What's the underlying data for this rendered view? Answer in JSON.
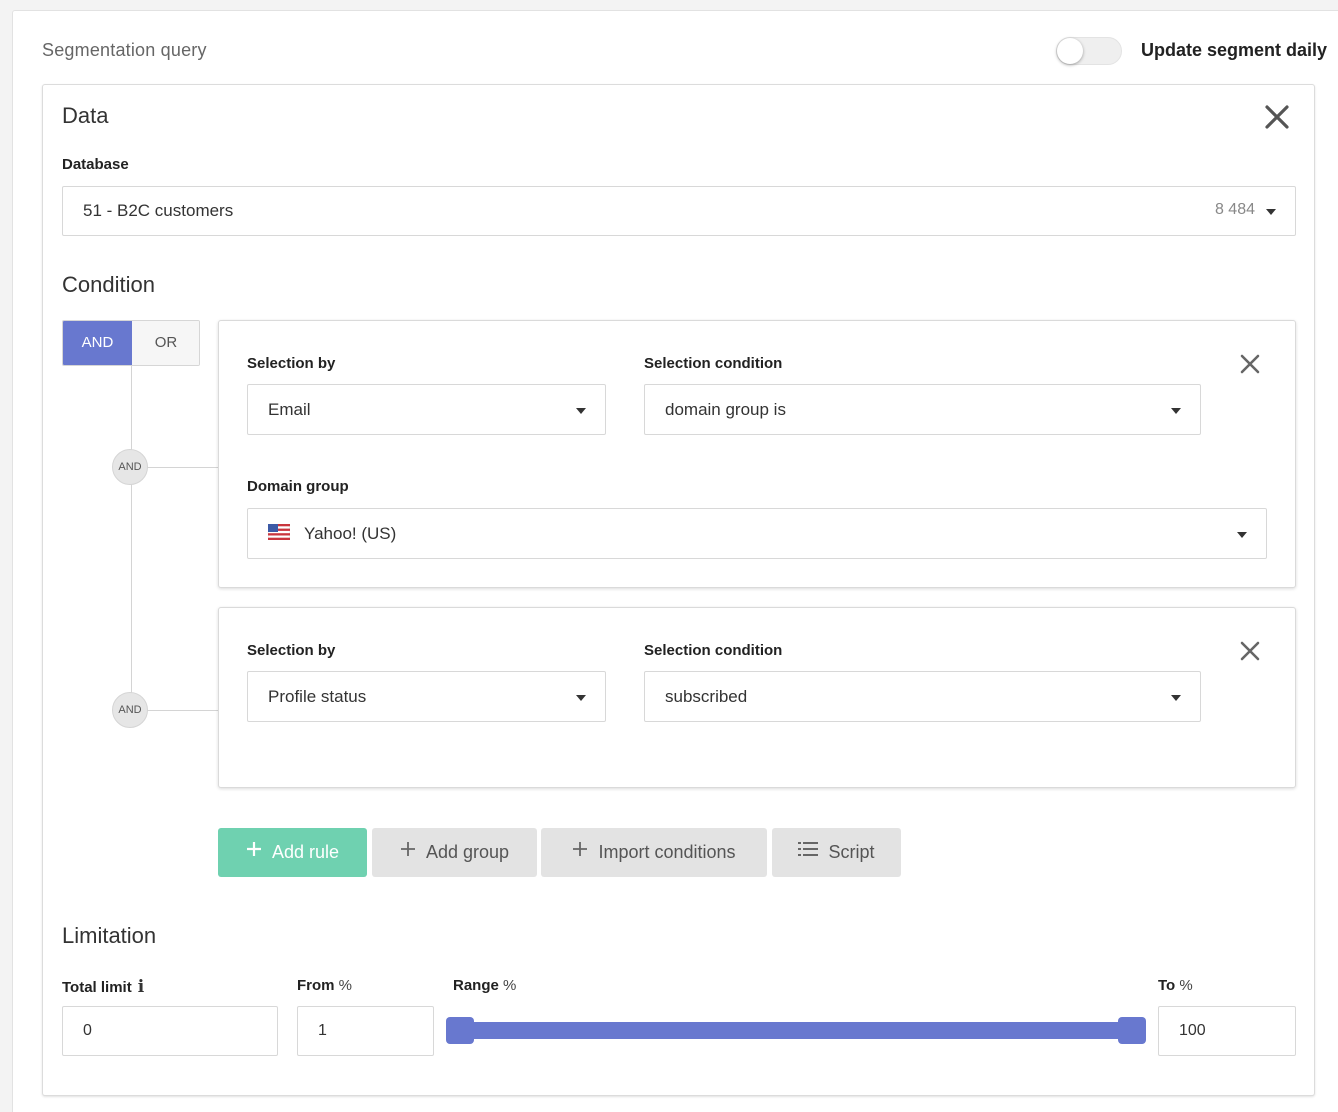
{
  "header": {
    "title": "Segmentation query",
    "toggle_label": "Update segment daily",
    "toggle_on": false
  },
  "data_section": {
    "title": "Data",
    "database_label": "Database",
    "database_value": "51 - B2C customers",
    "database_count": "8 484"
  },
  "condition": {
    "title": "Condition",
    "and_label": "AND",
    "or_label": "OR",
    "node_label": "AND",
    "rules": [
      {
        "selection_by_label": "Selection by",
        "selection_by_value": "Email",
        "selection_condition_label": "Selection condition",
        "selection_condition_value": "domain group is",
        "domain_group_label": "Domain group",
        "domain_group_value": "Yahoo! (US)",
        "domain_group_flag_icon": "us-flag-icon"
      },
      {
        "selection_by_label": "Selection by",
        "selection_by_value": "Profile status",
        "selection_condition_label": "Selection condition",
        "selection_condition_value": "subscribed"
      }
    ]
  },
  "actions": {
    "add_rule": "Add rule",
    "add_group": "Add group",
    "import_conditions": "Import conditions",
    "script": "Script"
  },
  "limitation": {
    "title": "Limitation",
    "total_limit_label": "Total limit",
    "total_limit_value": "0",
    "from_label": "From",
    "from_unit": "%",
    "from_value": "1",
    "range_label": "Range",
    "range_unit": "%",
    "to_label": "To",
    "to_unit": "%",
    "to_value": "100",
    "range_min": 1,
    "range_max": 100
  },
  "colors": {
    "accent": "#6878cf",
    "add_rule": "#6fd1b0"
  }
}
